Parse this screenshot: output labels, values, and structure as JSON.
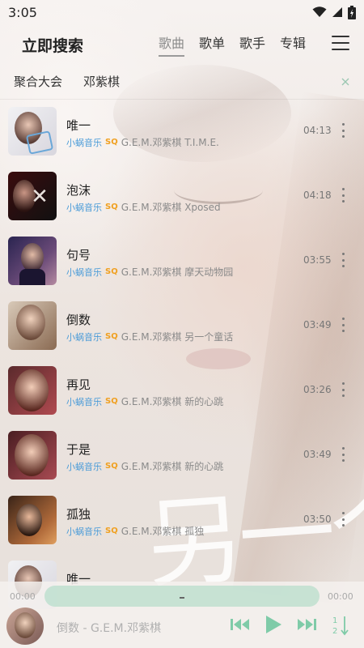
{
  "status_bar": {
    "time": "3:05"
  },
  "header": {
    "title": "立即搜索",
    "tabs": [
      {
        "label": "歌曲",
        "active": true
      },
      {
        "label": "歌单",
        "active": false
      },
      {
        "label": "歌手",
        "active": false
      },
      {
        "label": "专辑",
        "active": false
      }
    ]
  },
  "filter": {
    "source": "聚合大会",
    "query": "邓紫棋"
  },
  "songs": [
    {
      "title": "唯一",
      "source": "小蜗音乐",
      "quality": "SQ",
      "info": "G.E.M.邓紫棋 T.I.M.E.",
      "duration": "04:13"
    },
    {
      "title": "泡沫",
      "source": "小蜗音乐",
      "quality": "SQ",
      "info": "G.E.M.邓紫棋 Xposed",
      "duration": "04:18"
    },
    {
      "title": "句号",
      "source": "小蜗音乐",
      "quality": "SQ",
      "info": "G.E.M.邓紫棋 摩天动物园",
      "duration": "03:55"
    },
    {
      "title": "倒数",
      "source": "小蜗音乐",
      "quality": "SQ",
      "info": "G.E.M.邓紫棋 另一个童话",
      "duration": "03:49"
    },
    {
      "title": "再见",
      "source": "小蜗音乐",
      "quality": "SQ",
      "info": "G.E.M.邓紫棋 新的心跳",
      "duration": "03:26"
    },
    {
      "title": "于是",
      "source": "小蜗音乐",
      "quality": "SQ",
      "info": "G.E.M.邓紫棋 新的心跳",
      "duration": "03:49"
    },
    {
      "title": "孤独",
      "source": "小蜗音乐",
      "quality": "SQ",
      "info": "G.E.M.邓紫棋 孤独",
      "duration": "03:50"
    },
    {
      "title": "唯一",
      "source": "",
      "quality": "",
      "info": "",
      "duration": ""
    }
  ],
  "background": {
    "calligraphy": "另一个童"
  },
  "player": {
    "current_time": "00:00",
    "total_time": "00:00",
    "now_playing": "倒数 - G.E.M.邓紫棋",
    "progress": 0,
    "colors": {
      "accent": "#7fcba8",
      "track": "#bcdecd"
    }
  },
  "icons": [
    "wifi-icon",
    "signal-icon",
    "battery-icon",
    "menu-icon",
    "close-icon",
    "more-vertical-icon",
    "previous-icon",
    "play-icon",
    "next-icon",
    "sort-order-icon"
  ]
}
